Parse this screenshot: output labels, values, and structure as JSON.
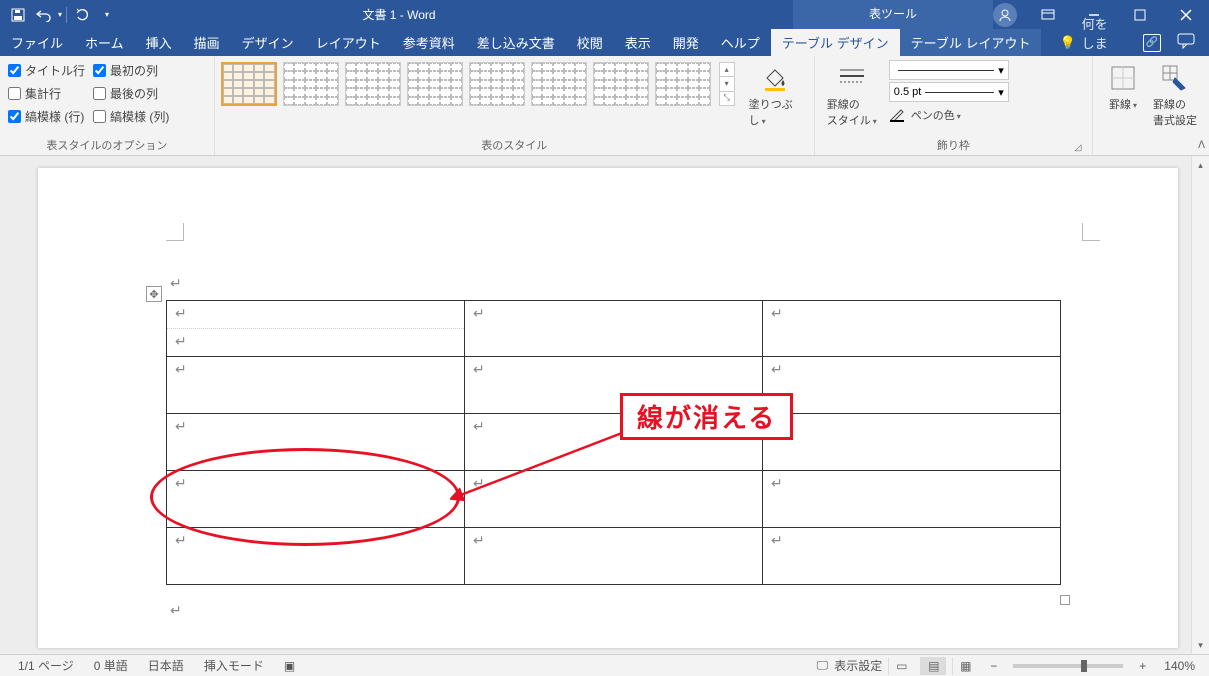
{
  "titlebar": {
    "doc_title": "文書 1 - Word",
    "tool_tab": "表ツール"
  },
  "tabs": {
    "file": "ファイル",
    "home": "ホーム",
    "insert": "挿入",
    "draw": "描画",
    "design": "デザイン",
    "layout": "レイアウト",
    "references": "参考資料",
    "mailings": "差し込み文書",
    "review": "校閲",
    "view": "表示",
    "developer": "開発",
    "help": "ヘルプ",
    "table_design": "テーブル デザイン",
    "table_layout": "テーブル レイアウト",
    "tell_me": "何をしますか"
  },
  "ribbon": {
    "style_options": {
      "header_row": "タイトル行",
      "first_col": "最初の列",
      "total_row": "集計行",
      "last_col": "最後の列",
      "banded_rows": "縞模様 (行)",
      "banded_cols": "縞模様 (列)",
      "label": "表スタイルのオプション"
    },
    "table_styles": {
      "label": "表のスタイル",
      "shading": "塗りつぶし"
    },
    "borders": {
      "label": "飾り枠",
      "border_styles": "罫線の\nスタイル",
      "pen_weight": "0.5 pt",
      "pen_color": "ペンの色",
      "borders_btn": "罫線",
      "border_painter": "罫線の\n書式設定"
    }
  },
  "annotation": {
    "text": "線が消える"
  },
  "statusbar": {
    "page": "1/1 ページ",
    "words": "0 単語",
    "lang": "日本語",
    "mode": "挿入モード",
    "display": "表示設定",
    "zoom": "140%"
  }
}
